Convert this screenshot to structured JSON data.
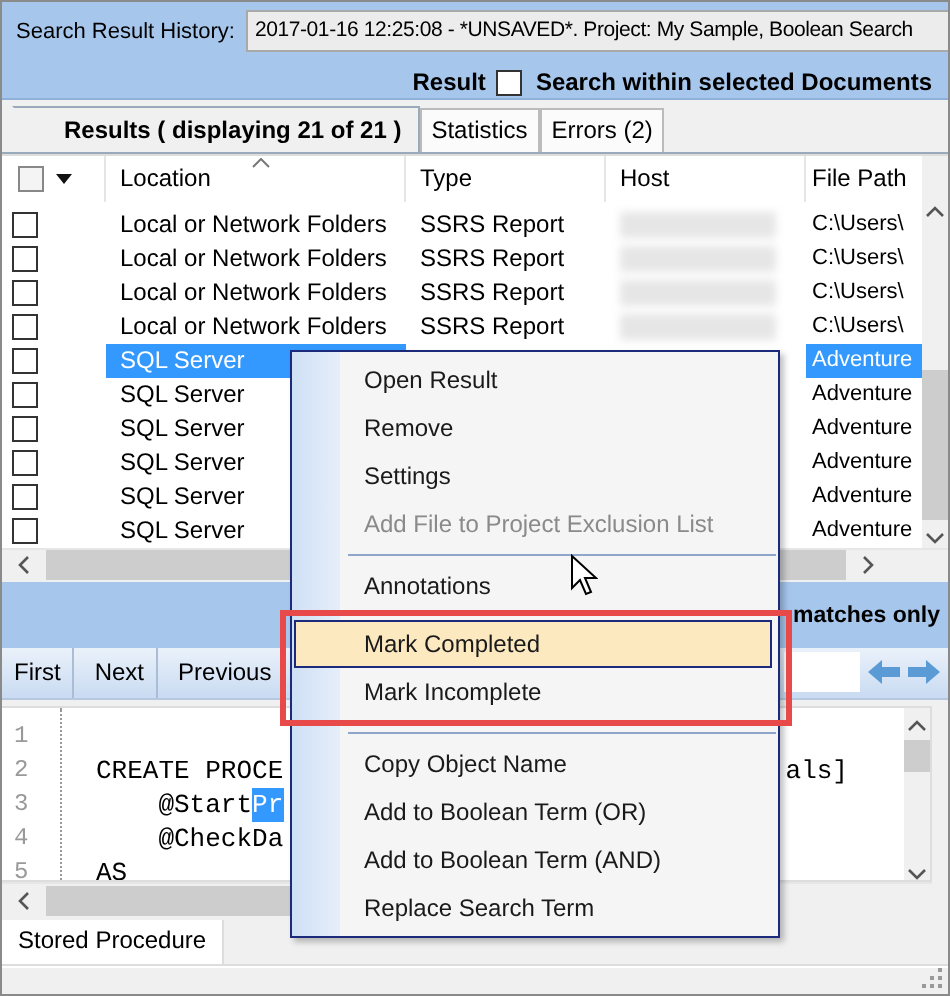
{
  "history": {
    "label": "Search Result History:",
    "value": "2017-01-16 12:25:08 - *UNSAVED*. Project: My Sample, Boolean Search"
  },
  "options": {
    "label": "Result",
    "checkbox": {
      "label": "Search within selected Documents",
      "checked": false
    }
  },
  "tabs": [
    {
      "label": "Results ( displaying 21 of 21 )",
      "selected": true
    },
    {
      "label": "Statistics",
      "selected": false
    },
    {
      "label": "Errors (2)",
      "selected": false
    }
  ],
  "table": {
    "select_all_checked": false,
    "columns": [
      "Location",
      "Type",
      "Host",
      "File Path"
    ],
    "rows": [
      {
        "checked": false,
        "selected": false,
        "location": "Local or Network Folders",
        "type": "SSRS Report",
        "host_blurred": true,
        "file_path": "C:\\Users\\"
      },
      {
        "checked": false,
        "selected": false,
        "location": "Local or Network Folders",
        "type": "SSRS Report",
        "host_blurred": true,
        "file_path": "C:\\Users\\"
      },
      {
        "checked": false,
        "selected": false,
        "location": "Local or Network Folders",
        "type": "SSRS Report",
        "host_blurred": true,
        "file_path": "C:\\Users\\"
      },
      {
        "checked": false,
        "selected": false,
        "location": "Local or Network Folders",
        "type": "SSRS Report",
        "host_blurred": true,
        "file_path": "C:\\Users\\"
      },
      {
        "checked": false,
        "selected": true,
        "location": "SQL Server",
        "file_path": "Adventure"
      },
      {
        "checked": false,
        "selected": false,
        "location": "SQL Server",
        "file_path": "Adventure"
      },
      {
        "checked": false,
        "selected": false,
        "location": "SQL Server",
        "file_path": "Adventure"
      },
      {
        "checked": false,
        "selected": false,
        "location": "SQL Server",
        "file_path": "Adventure"
      },
      {
        "checked": false,
        "selected": false,
        "location": "SQL Server",
        "file_path": "Adventure"
      },
      {
        "checked": false,
        "selected": false,
        "location": "SQL Server",
        "file_path": "Adventure"
      }
    ]
  },
  "filter": {
    "label": "matches only"
  },
  "nav_buttons": [
    "First",
    "Next",
    "Previous"
  ],
  "code": [
    {
      "number": "1"
    },
    {
      "number": "2",
      "text": "CREATE PROCE",
      "tail": "als]"
    },
    {
      "number": "3",
      "text": "    @Start",
      "highlight": "Pr"
    },
    {
      "number": "4",
      "text": "    @CheckDa"
    },
    {
      "number": "5",
      "text": "AS"
    }
  ],
  "bottom_tabs": [
    {
      "label": "Stored Procedure",
      "selected": true
    }
  ],
  "context_menu": [
    {
      "kind": "item",
      "label": "Open Result",
      "disabled": false,
      "hovered": false,
      "highlighted": false
    },
    {
      "kind": "item",
      "label": "Remove",
      "disabled": false,
      "hovered": false,
      "highlighted": false
    },
    {
      "kind": "item",
      "label": "Settings",
      "disabled": false,
      "hovered": false,
      "highlighted": false
    },
    {
      "kind": "item",
      "label": "Add File to Project Exclusion List",
      "disabled": true,
      "hovered": false,
      "highlighted": false
    },
    {
      "kind": "separator"
    },
    {
      "kind": "item",
      "label": "Annotations",
      "disabled": false,
      "hovered": false,
      "highlighted": false
    },
    {
      "kind": "item",
      "label": "Mark Completed",
      "disabled": false,
      "hovered": true,
      "highlighted": true
    },
    {
      "kind": "item",
      "label": "Mark Incomplete",
      "disabled": false,
      "hovered": false,
      "highlighted": true
    },
    {
      "kind": "separator"
    },
    {
      "kind": "item",
      "label": "Copy Object Name",
      "disabled": false,
      "hovered": false,
      "highlighted": false
    },
    {
      "kind": "item",
      "label": "Add to Boolean Term (OR)",
      "disabled": false,
      "hovered": false,
      "highlighted": false
    },
    {
      "kind": "item",
      "label": "Add to Boolean Term (AND)",
      "disabled": false,
      "hovered": false,
      "highlighted": false
    },
    {
      "kind": "item",
      "label": "Replace Search Term",
      "disabled": false,
      "hovered": false,
      "highlighted": false
    }
  ]
}
